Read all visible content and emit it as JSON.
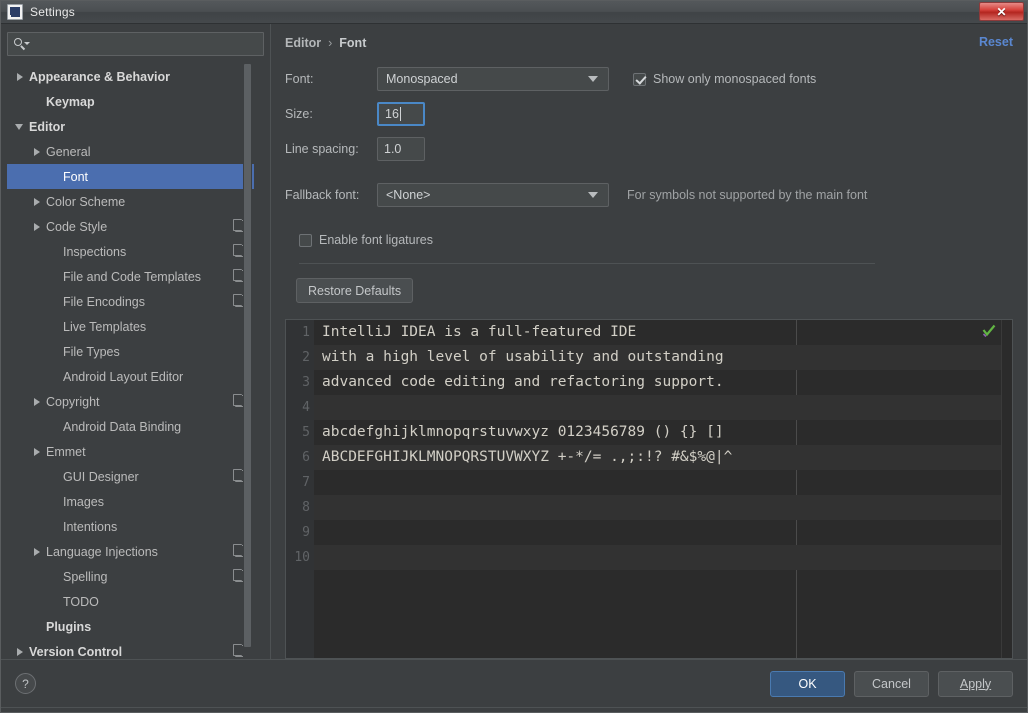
{
  "window": {
    "title": "Settings",
    "app_icon": "intellij-idea-icon",
    "close_label": "✕"
  },
  "sidebar": {
    "search": {
      "value": "",
      "placeholder": "",
      "icon": "search-icon"
    },
    "items": [
      {
        "label": "Appearance & Behavior",
        "indent": 0,
        "arrow": "closed",
        "bold": true,
        "copy": false,
        "selected": false
      },
      {
        "label": "Keymap",
        "indent": 1,
        "arrow": "none",
        "bold": true,
        "copy": false,
        "selected": false
      },
      {
        "label": "Editor",
        "indent": 0,
        "arrow": "open",
        "bold": true,
        "copy": false,
        "selected": false
      },
      {
        "label": "General",
        "indent": 1,
        "arrow": "closed",
        "bold": false,
        "copy": false,
        "selected": false
      },
      {
        "label": "Font",
        "indent": 2,
        "arrow": "none",
        "bold": false,
        "copy": false,
        "selected": true
      },
      {
        "label": "Color Scheme",
        "indent": 1,
        "arrow": "closed",
        "bold": false,
        "copy": false,
        "selected": false
      },
      {
        "label": "Code Style",
        "indent": 1,
        "arrow": "closed",
        "bold": false,
        "copy": true,
        "selected": false
      },
      {
        "label": "Inspections",
        "indent": 2,
        "arrow": "none",
        "bold": false,
        "copy": true,
        "selected": false
      },
      {
        "label": "File and Code Templates",
        "indent": 2,
        "arrow": "none",
        "bold": false,
        "copy": true,
        "selected": false
      },
      {
        "label": "File Encodings",
        "indent": 2,
        "arrow": "none",
        "bold": false,
        "copy": true,
        "selected": false
      },
      {
        "label": "Live Templates",
        "indent": 2,
        "arrow": "none",
        "bold": false,
        "copy": false,
        "selected": false
      },
      {
        "label": "File Types",
        "indent": 2,
        "arrow": "none",
        "bold": false,
        "copy": false,
        "selected": false
      },
      {
        "label": "Android Layout Editor",
        "indent": 2,
        "arrow": "none",
        "bold": false,
        "copy": false,
        "selected": false
      },
      {
        "label": "Copyright",
        "indent": 1,
        "arrow": "closed",
        "bold": false,
        "copy": true,
        "selected": false
      },
      {
        "label": "Android Data Binding",
        "indent": 2,
        "arrow": "none",
        "bold": false,
        "copy": false,
        "selected": false
      },
      {
        "label": "Emmet",
        "indent": 1,
        "arrow": "closed",
        "bold": false,
        "copy": false,
        "selected": false
      },
      {
        "label": "GUI Designer",
        "indent": 2,
        "arrow": "none",
        "bold": false,
        "copy": true,
        "selected": false
      },
      {
        "label": "Images",
        "indent": 2,
        "arrow": "none",
        "bold": false,
        "copy": false,
        "selected": false
      },
      {
        "label": "Intentions",
        "indent": 2,
        "arrow": "none",
        "bold": false,
        "copy": false,
        "selected": false
      },
      {
        "label": "Language Injections",
        "indent": 1,
        "arrow": "closed",
        "bold": false,
        "copy": true,
        "selected": false
      },
      {
        "label": "Spelling",
        "indent": 2,
        "arrow": "none",
        "bold": false,
        "copy": true,
        "selected": false
      },
      {
        "label": "TODO",
        "indent": 2,
        "arrow": "none",
        "bold": false,
        "copy": false,
        "selected": false
      },
      {
        "label": "Plugins",
        "indent": 1,
        "arrow": "none",
        "bold": true,
        "copy": false,
        "selected": false
      },
      {
        "label": "Version Control",
        "indent": 0,
        "arrow": "closed",
        "bold": true,
        "copy": true,
        "selected": false
      }
    ]
  },
  "content": {
    "breadcrumb": {
      "root": "Editor",
      "separator": "›",
      "current": "Font"
    },
    "reset_label": "Reset",
    "font_row": {
      "label": "Font:",
      "value": "Monospaced"
    },
    "size_row": {
      "label": "Size:",
      "value": "16"
    },
    "spacing_row": {
      "label": "Line spacing:",
      "value": "1.0"
    },
    "fallback_row": {
      "label": "Fallback font:",
      "value": "<None>",
      "hint": "For symbols not supported by the main font"
    },
    "monospaced_checkbox": {
      "label": "Show only monospaced fonts",
      "checked": true
    },
    "ligatures_checkbox": {
      "label": "Enable font ligatures",
      "checked": false
    },
    "restore_defaults_label": "Restore Defaults"
  },
  "preview": {
    "inspection_icon": "green-checkmark-icon",
    "line_numbers": [
      "1",
      "2",
      "3",
      "4",
      "5",
      "6",
      "7",
      "8",
      "9",
      "10"
    ],
    "lines": [
      "IntelliJ IDEA is a full-featured IDE",
      "with a high level of usability and outstanding",
      "advanced code editing and refactoring support.",
      "",
      "abcdefghijklmnopqrstuvwxyz 0123456789 () {} []",
      "ABCDEFGHIJKLMNOPQRSTUVWXYZ +-*/= .,;:!? #&$%@|^",
      "",
      "",
      "",
      ""
    ]
  },
  "footer": {
    "help_label": "?",
    "ok_label": "OK",
    "cancel_label": "Cancel",
    "apply_label": "Apply"
  },
  "colors": {
    "accent_blue": "#4b6eaf",
    "primary_button": "#365880",
    "link": "#5a87d0",
    "panel_bg": "#3c3f41",
    "editor_bg": "#2b2b2b",
    "close_red": "#b32620",
    "checkmark_green": "#62b543"
  }
}
